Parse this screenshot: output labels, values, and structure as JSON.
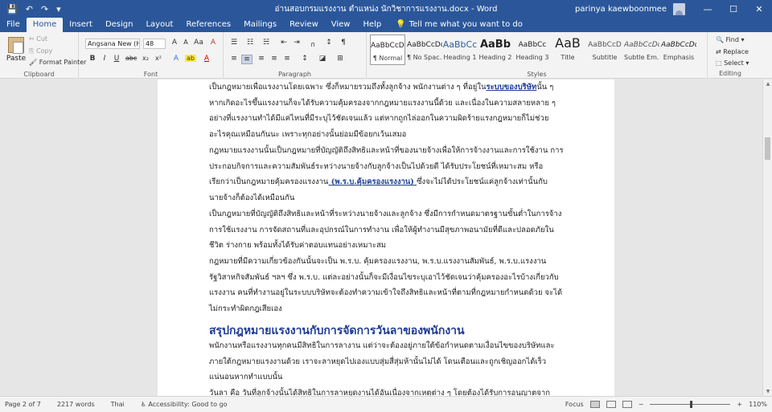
{
  "titlebar": {
    "doc_title": "อ่านสอบกรมแรงงาน ตำแหน่ง นักวิชาการแรงงาน.docx - Word",
    "user": "parinya kaewboonmee",
    "qat_save": "💾",
    "qat_undo": "↶",
    "qat_redo": "↷",
    "qat_more": "▾",
    "min": "—",
    "max": "☐",
    "close": "✕"
  },
  "menu": {
    "tabs": [
      "File",
      "Home",
      "Insert",
      "Design",
      "Layout",
      "References",
      "Mailings",
      "Review",
      "View",
      "Help"
    ],
    "tell_icon": "💡",
    "tell_me": "Tell me what you want to do"
  },
  "ribbon": {
    "clipboard": {
      "paste": "Paste",
      "cut": "✂ Cut",
      "copy": "⎘ Copy",
      "format_painter": "🖌 Format Painter",
      "label": "Clipboard"
    },
    "font": {
      "name": "Angsana New (He...",
      "size": "48",
      "grow": "A",
      "shrink": "A",
      "case": "Aa",
      "clear": "A",
      "bold": "B",
      "italic": "I",
      "underline": "U",
      "strike": "abc",
      "sub": "x₂",
      "sup": "x²",
      "effects": "A",
      "highlight": "ab",
      "color": "A",
      "label": "Font"
    },
    "paragraph": {
      "bullets": "☰",
      "numbering": "☷",
      "multilevel": "☵",
      "decrease": "⇤",
      "increase": "⇥",
      "thai": "ก",
      "sort": "↕",
      "marks": "¶",
      "align_left": "≡",
      "center": "≡",
      "align_right": "≡",
      "justify": "≡",
      "distributed": "≡",
      "spacing": "↕",
      "shading": "◪",
      "borders": "⊞",
      "label": "Paragraph"
    },
    "styles": {
      "items": [
        {
          "preview": "AaBbCcDd",
          "name": "¶ Normal"
        },
        {
          "preview": "AaBbCcDd",
          "name": "¶ No Spac..."
        },
        {
          "preview": "AaBbCc",
          "name": "Heading 1"
        },
        {
          "preview": "AaBb",
          "name": "Heading 2"
        },
        {
          "preview": "AaBbCc",
          "name": "Heading 3"
        },
        {
          "preview": "AaB",
          "name": "Title"
        },
        {
          "preview": "AaBbCcD",
          "name": "Subtitle"
        },
        {
          "preview": "AaBbCcDd",
          "name": "Subtle Em..."
        },
        {
          "preview": "AaBbCcDd",
          "name": "Emphasis"
        }
      ],
      "label": "Styles"
    },
    "editing": {
      "find": "🔍 Find ▾",
      "replace": "⇄ Replace",
      "select": "⬚ Select ▾",
      "label": "Editing"
    }
  },
  "document": {
    "paragraphs": [
      {
        "lines": [
          {
            "pre": "เป็นกฎหมายเพื่อแรงงานโดยเฉพาะ ซึ่งก็หมายรวมถึงทั้งลูกจ้าง พนักงานต่าง ๆ ที่อยู่ใน",
            "link": "ระบบของบริษัท",
            "post": "นั้น ๆ"
          },
          {
            "pre": "หากเกิดอะไรขึ้นแรงงานก็จะได้รับความคุ้มครองจากกฎหมายแรงงานนี้ด้วย และเนื่องในความสลายหลาย ๆ"
          },
          {
            "pre": "อย่างที่แรงงานทำได้มีแค่ไหนที่มีระบุไว้ชัดเจนแล้ว แต่หากถูกไล่ออกในความผิดร้ายแรงกฎหมายก็ไม่ช่วย"
          },
          {
            "pre": "อะไรคุณเหมือนกันนะ เพราะทุกอย่างนั้นย่อมมีข้อยกเว้นเสมอ"
          }
        ]
      },
      {
        "lines": [
          {
            "pre": "กฎหมายแรงงานนั้นเป็นกฎหมายที่บัญญัติถึงสิทธิและหน้าที่ของนายจ้างเพื่อให้การจ้างงานและการใช้งาน การ"
          },
          {
            "pre": "ประกอบกิจการและความสัมพันธ์ระหว่างนายจ้างกับลูกจ้างเป็นไปด้วยดี ได้รับประโยชน์ที่เหมาะสม หรือ"
          },
          {
            "pre": "เรียกว่าเป็นกฎหมายคุ้มครองแรงงาน",
            "link": " (พ.ร.บ.คุ้มครองแรงงาน) ",
            "post": "ซึ่งจะไม่ได้ประโยชน์แค่ลูกจ้างเท่านั้นกับ"
          },
          {
            "pre": "นายจ้างก็ต้องได้เหมือนกัน"
          }
        ]
      },
      {
        "lines": [
          {
            "pre": "เป็นกฎหมายที่บัญญัติถึงสิทธิและหน้าที่ระหว่างนายจ้างและลูกจ้าง ซึ่งมีการกำหนดมาตรฐานขั้นต่ำในการจ้าง"
          },
          {
            "pre": "การใช้แรงงาน การจัดสถานที่และอุปกรณ์ในการทำงาน เพื่อให้ผู้ทำงานมีสุขภาพอนามัยที่ดีและปลอดภัยใน"
          },
          {
            "pre": "ชีวิต ร่างกาย พร้อมทั้งได้รับค่าตอบแทนอย่างเหมาะสม"
          }
        ]
      },
      {
        "lines": [
          {
            "pre": "กฎหมายที่มีความเกี่ยวข้องกันนั้นจะเป็น พ.ร.บ. คุ้มครองแรงงาน, พ.ร.บ.แรงงานสัมพันธ์, พ.ร.บ.แรงงาน"
          },
          {
            "pre": "รัฐวิสาหกิจสัมพันธ์ ฯลฯ ซึ่ง พ.ร.บ. แต่ละอย่างนั้นก็จะมีเงื่อนไขระบุเอาไว้ชัดเจนว่าคุ้มครองอะไรบ้างเกี่ยวกับ"
          },
          {
            "pre": "แรงงาน คนที่ทำงานอยู่ในระบบบริษัทจะต้องทำความเข้าใจถึงสิทธิและหน้าที่ตามที่กฎหมายกำหนดด้วย จะได้"
          },
          {
            "pre": "ไม่กระทำผิดกฎเสียเอง"
          }
        ]
      }
    ],
    "heading": "สรุปกฎหมายแรงงานกับการจัดการวันลาของพนักงาน",
    "after": [
      {
        "lines": [
          {
            "pre": "พนักงานหรือแรงงานทุกคนมีสิทธิในการลางาน แต่ว่าจะต้องอยู่ภายใต้ข้อกำหนดตามเงื่อนไขของบริษัทและ"
          },
          {
            "pre": "ภายใต้กฎหมายแรงงานด้วย เราจะลาหยุดไปเองแบบสุ่มสี่สุ่มห้านั้นไม่ได้ โดนเตือนและถูกเชิญออกได้เร็ว"
          },
          {
            "pre": "แน่นอนหากทำแบบนั้น"
          }
        ]
      },
      {
        "lines": [
          {
            "pre": "วันลา คือ วันที่ลูกจ้างนั้นได้สิทธิในการลาหยุดงานได้อันเนื่องจากเหตุต่าง ๆ โดยต้องได้รับการอนุญาตจาก"
          }
        ]
      }
    ]
  },
  "status": {
    "page": "Page 2 of 7",
    "words": "2217 words",
    "lang": "Thai",
    "access": "♿ Accessibility: Good to go",
    "focus": "Focus",
    "minus": "−",
    "plus": "+",
    "zoom": "110%"
  }
}
